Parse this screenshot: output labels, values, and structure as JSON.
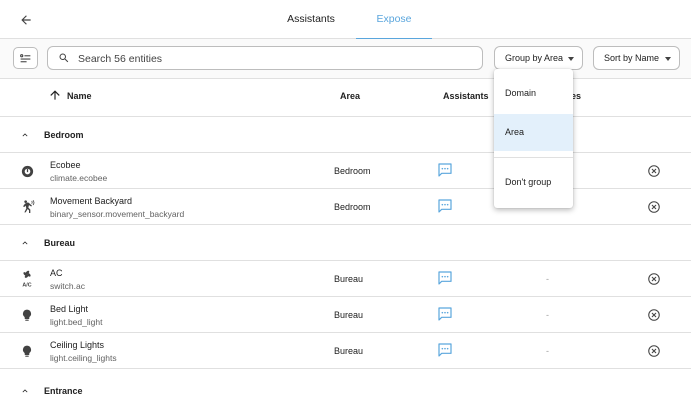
{
  "tabs": {
    "assistants": "Assistants",
    "expose": "Expose"
  },
  "search": {
    "placeholder": "Search 56 entities"
  },
  "toolbar": {
    "group_by": "Group by Area",
    "sort_by": "Sort by Name"
  },
  "columns": {
    "name": "Name",
    "area": "Area",
    "assistants": "Assistants",
    "aliases_tail": "es"
  },
  "groups": {
    "bedroom": "Bedroom",
    "bureau": "Bureau",
    "entrance": "Entrance"
  },
  "rows": [
    {
      "name": "Ecobee",
      "entity_id": "climate.ecobee",
      "area": "Bedroom",
      "alias": "",
      "icon": "thermostat-icon"
    },
    {
      "name": "Movement Backyard",
      "entity_id": "binary_sensor.movement_backyard",
      "area": "Bedroom",
      "alias": "",
      "icon": "motion-sensor-icon"
    },
    {
      "name": "AC",
      "entity_id": "switch.ac",
      "area": "Bureau",
      "alias": "-",
      "icon": "air-conditioner-icon"
    },
    {
      "name": "Bed Light",
      "entity_id": "light.bed_light",
      "area": "Bureau",
      "alias": "-",
      "icon": "lightbulb-icon"
    },
    {
      "name": "Ceiling Lights",
      "entity_id": "light.ceiling_lights",
      "area": "Bureau",
      "alias": "-",
      "icon": "lightbulb-icon"
    }
  ],
  "group_menu": {
    "domain": "Domain",
    "area": "Area",
    "dont_group": "Don't group"
  },
  "colors": {
    "accent": "#5aa6dd",
    "selected_bg": "#e3f0fb",
    "divider": "#e0e0e0"
  }
}
